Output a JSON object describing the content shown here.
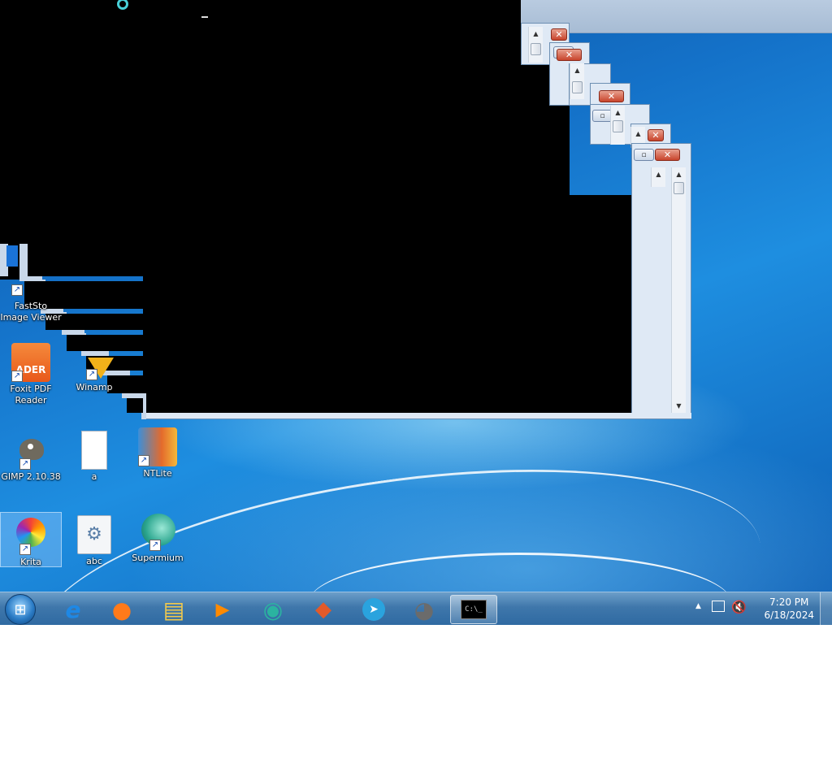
{
  "desktop": {
    "icons": [
      {
        "name": "faststone-icon",
        "label": "FastSto\nImage Viewer"
      },
      {
        "name": "foxit-icon",
        "label": "Foxit PDF\nReader",
        "badge": "ADER"
      },
      {
        "name": "winamp-icon",
        "label": "Winamp"
      },
      {
        "name": "gimp-icon",
        "label": "GIMP 2.10.38"
      },
      {
        "name": "text-file-icon",
        "label": "a"
      },
      {
        "name": "ntlite-icon",
        "label": "NTLite"
      },
      {
        "name": "krita-icon",
        "label": "Krita"
      },
      {
        "name": "settings-file-icon",
        "label": "abc"
      },
      {
        "name": "supermium-icon",
        "label": "Supermium"
      }
    ]
  },
  "windows": {
    "close_glyph": "✕",
    "restore_glyph": "▫",
    "scroll_up": "▲",
    "scroll_down": "▼"
  },
  "taskbar": {
    "start_glyph": "⊞",
    "apps": [
      {
        "name": "internet-explorer-icon",
        "glyph": "e",
        "color": "#1e88e5"
      },
      {
        "name": "firefox-icon",
        "glyph": "●",
        "color": "#ff7a1a"
      },
      {
        "name": "file-explorer-icon",
        "glyph": "▤",
        "color": "#f2c94c"
      },
      {
        "name": "media-player-icon",
        "glyph": "▶",
        "color": "#ff8a00"
      },
      {
        "name": "supermium-icon",
        "glyph": "◉",
        "color": "#2bb3a0"
      },
      {
        "name": "ntlite-icon",
        "glyph": "◆",
        "color": "#e25a2a"
      },
      {
        "name": "telegram-icon",
        "glyph": "➤",
        "color": "#2aa3de"
      },
      {
        "name": "gimp-icon",
        "glyph": "◕",
        "color": "#6b6b6b"
      },
      {
        "name": "command-prompt-icon",
        "glyph": "C:\\_",
        "color": "#000000"
      }
    ],
    "tray": {
      "time": "7:20 PM",
      "date": "6/18/2024",
      "show_hidden_glyph": "▲"
    }
  }
}
